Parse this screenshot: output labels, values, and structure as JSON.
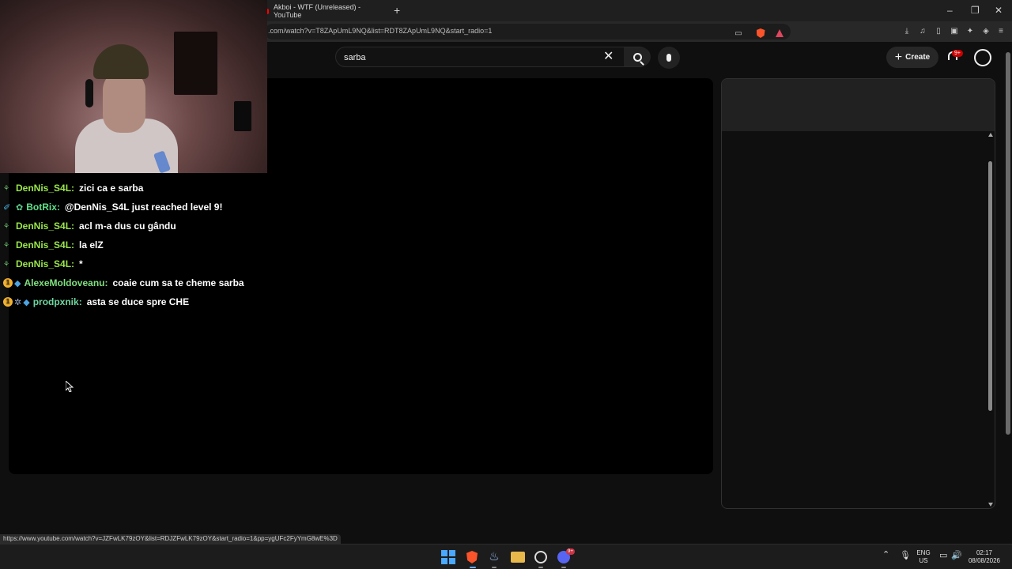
{
  "browser": {
    "tab_title": "Akboi - WTF (Unreleased) - YouTube",
    "new_tab_label": "+",
    "url": ".com/watch?v=T8ZApUmL9NQ&list=RDT8ZApUmL9NQ&start_radio=1",
    "window_controls": {
      "minimize": "–",
      "maximize": "❐",
      "close": "✕"
    },
    "status_url": "https://www.youtube.com/watch?v=JZFwLK79zOY&list=RDJZFwLK79zOY&start_radio=1&pp=ygUFc2FyYmG8wE%3D"
  },
  "youtube": {
    "search_value": "sarba",
    "create_label": "Create",
    "create_plus": "+",
    "clear_symbol": "✕",
    "notification_badge": "9+"
  },
  "chat": {
    "messages": [
      {
        "user": "DenNis_S4L:",
        "text": "zici ca e sarba",
        "color": "#9be64b"
      },
      {
        "user": "BotRix:",
        "text": "@DenNis_S4L just reached level 9!",
        "color": "#5fe08a"
      },
      {
        "user": "DenNis_S4L:",
        "text": "acl m-a dus cu gându",
        "color": "#9be64b"
      },
      {
        "user": "DenNis_S4L:",
        "text": "la elZ",
        "color": "#9be64b"
      },
      {
        "user": "DenNis_S4L:",
        "text": "*",
        "color": "#9be64b"
      },
      {
        "user": "AlexeMoldoveanu:",
        "text": "coaie cum sa te cheme sarba",
        "color": "#7fe07f"
      },
      {
        "user": "prodpxnik:",
        "text": "asta se duce spre CHE",
        "color": "#6fd6a0"
      }
    ],
    "badge_one": "1"
  },
  "taskbar": {
    "lang_top": "ENG",
    "lang_bottom": "US",
    "time": "02:17",
    "date": "08/08/2026",
    "discord_badge": "9+"
  },
  "colors": {
    "youtube_red": "#ff0000",
    "brave_orange": "#fb542b",
    "windows_blue": "#4aa8ff"
  }
}
